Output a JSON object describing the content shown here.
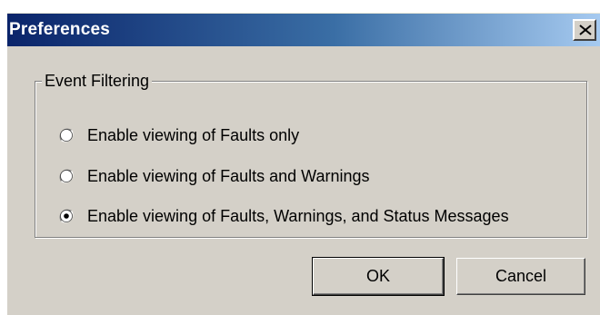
{
  "window": {
    "title": "Preferences",
    "close_label": "X"
  },
  "event_filtering": {
    "legend": "Event Filtering",
    "options": [
      {
        "label": "Enable viewing of Faults only",
        "selected": false
      },
      {
        "label": "Enable viewing of Faults and Warnings",
        "selected": false
      },
      {
        "label": "Enable viewing of Faults, Warnings, and Status Messages",
        "selected": true
      }
    ]
  },
  "buttons": {
    "ok_label": "OK",
    "cancel_label": "Cancel"
  },
  "colors": {
    "titlebar_start": "#0a246a",
    "titlebar_end": "#a6caf0",
    "dialog_face": "#d4d0c8"
  }
}
